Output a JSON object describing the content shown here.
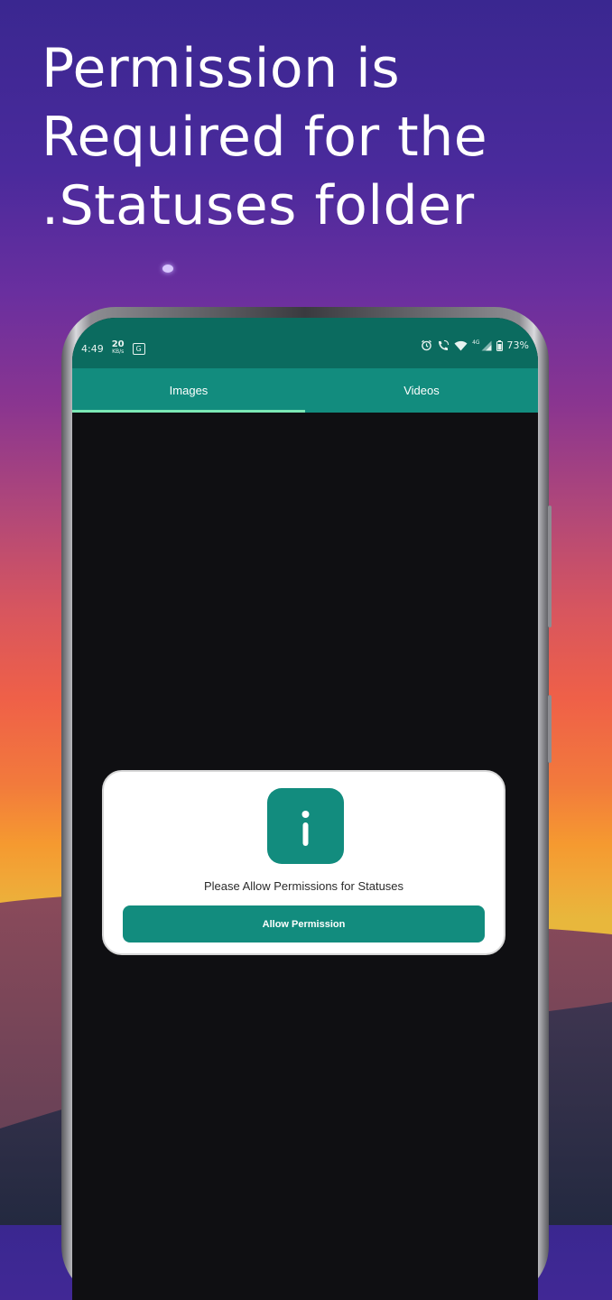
{
  "headline": {
    "lines": [
      "Permission is",
      "Required for the",
      ".Statuses folder"
    ]
  },
  "status_bar": {
    "time": "4:49",
    "net_speed_value": "20",
    "net_speed_unit": "KB/s",
    "sim_badge": "G",
    "network_type": "4G",
    "battery": "73%",
    "icons": [
      "alarm-icon",
      "wifi-calling-icon",
      "wifi-icon",
      "signal-icon",
      "battery-icon"
    ]
  },
  "tabs": [
    {
      "label": "Images",
      "active": true
    },
    {
      "label": "Videos",
      "active": false
    }
  ],
  "dialog": {
    "icon": "info-icon",
    "message": "Please Allow Permissions for Statuses",
    "button_label": "Allow Permission"
  },
  "colors": {
    "brand_teal": "#128c7e",
    "status_bar": "#0b6b5f",
    "tab_indicator": "#7be8b5",
    "screen_background": "#0f0f12"
  }
}
